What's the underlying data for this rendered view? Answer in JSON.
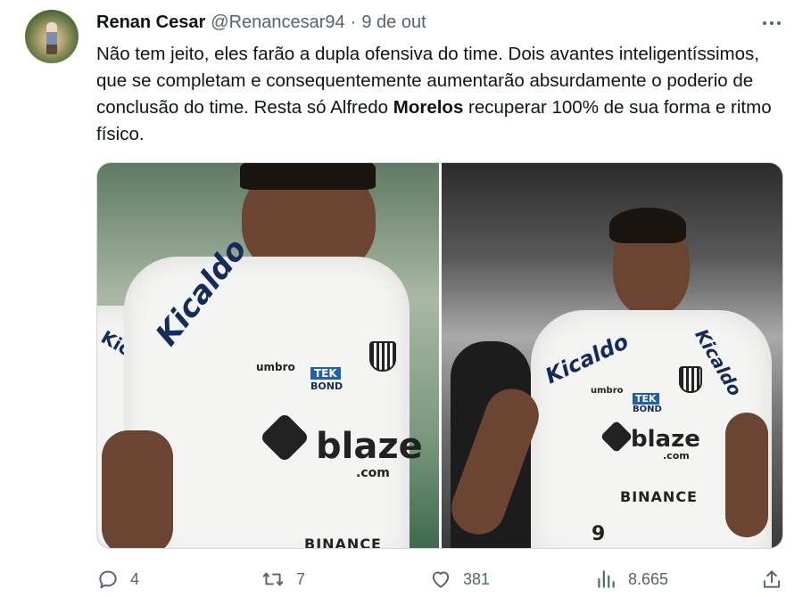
{
  "author": {
    "name": "Renan Cesar",
    "handle": "@Renancesar94",
    "separator": "·",
    "date": "9 de out"
  },
  "tweet": {
    "text_before": "Não tem jeito, eles farão a dupla ofensiva do time. Dois avantes inteligentíssimos, que se completam e consequentemente aumentarão absurdamente o poderio de conclusão do time. Resta só Alfredo ",
    "text_bold": "Morelos",
    "text_after": " recuperar 100% de sua forma e ritmo físico."
  },
  "media": {
    "left_photo": {
      "sponsor_sleeve": "Kicaldo",
      "sponsor_sleeve_left": "Kic",
      "kit_brand": "umbro",
      "tek_top": "TEK",
      "tek_bottom": "BOND",
      "main_sponsor": "blaze",
      "main_sponsor_sub": ".com",
      "bottom_sponsor": "BINANCE"
    },
    "right_photo": {
      "sponsor_sleeve": "Kicaldo",
      "sponsor_sleeve_right": "Kicaldo",
      "kit_brand": "umbro",
      "tek_top": "TEK",
      "tek_bottom": "BOND",
      "main_sponsor": "blaze",
      "main_sponsor_sub": ".com",
      "bottom_sponsor": "BINANCE",
      "shorts_number": "9"
    }
  },
  "actions": {
    "replies": "4",
    "retweets": "7",
    "likes": "381",
    "views": "8.665"
  },
  "colors": {
    "text": "#0f1419",
    "secondary": "#536471",
    "border": "#cfd9de"
  }
}
